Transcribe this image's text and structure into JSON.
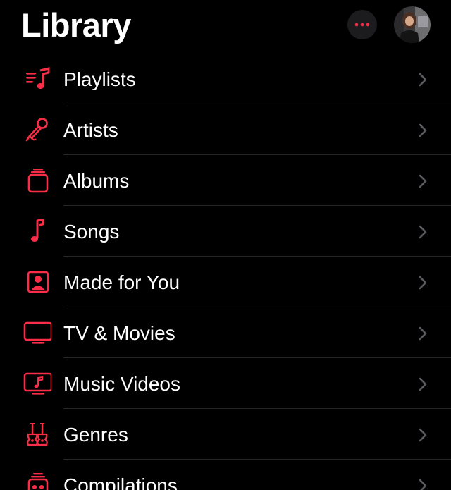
{
  "header": {
    "title": "Library",
    "more_icon": "ellipsis-icon",
    "avatar_icon": "profile-avatar"
  },
  "colors": {
    "accent": "#fa2d48",
    "background": "#000000",
    "separator": "#262628",
    "chevron": "#5a5a5e",
    "button_bg": "#1c1c1e"
  },
  "library": {
    "items": [
      {
        "label": "Playlists",
        "icon": "playlist-icon"
      },
      {
        "label": "Artists",
        "icon": "microphone-icon"
      },
      {
        "label": "Albums",
        "icon": "album-stack-icon"
      },
      {
        "label": "Songs",
        "icon": "music-note-icon"
      },
      {
        "label": "Made for You",
        "icon": "person-square-icon"
      },
      {
        "label": "TV & Movies",
        "icon": "tv-icon"
      },
      {
        "label": "Music Videos",
        "icon": "music-video-icon"
      },
      {
        "label": "Genres",
        "icon": "guitars-icon"
      },
      {
        "label": "Compilations",
        "icon": "compilation-icon"
      }
    ]
  }
}
